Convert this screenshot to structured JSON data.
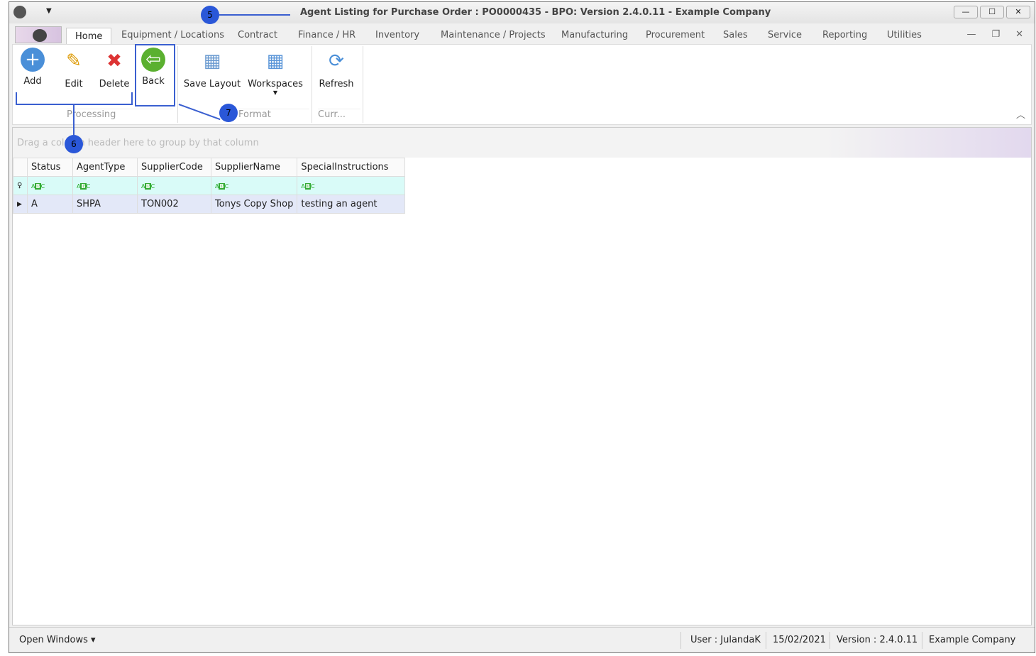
{
  "window": {
    "title": "Agent Listing for Purchase Order : PO0000435 - BPO: Version 2.4.0.11 - Example Company",
    "buttons": [
      "—",
      "☐",
      "✕"
    ]
  },
  "tabs": [
    "Home",
    "Equipment / Locations",
    "Contract",
    "Finance / HR",
    "Inventory",
    "Maintenance / Projects",
    "Manufacturing",
    "Procurement",
    "Sales",
    "Service",
    "Reporting",
    "Utilities"
  ],
  "ribbon": {
    "add": "Add",
    "edit": "Edit",
    "delete": "Delete",
    "back": "Back",
    "save_layout": "Save Layout",
    "workspaces": "Workspaces",
    "refresh": "Refresh",
    "group_processing": "Processing",
    "group_format": "Format",
    "group_curr": "Curr..."
  },
  "grid": {
    "group_hint": "Drag a column header here to group by that column",
    "columns": [
      "Status",
      "AgentType",
      "SupplierCode",
      "SupplierName",
      "SpecialInstructions"
    ],
    "rows": [
      [
        "A",
        "SHPA",
        "TON002",
        "Tonys Copy Shop",
        "testing an agent"
      ]
    ]
  },
  "statusbar": {
    "open_windows": "Open Windows ▾",
    "user": "User : JulandaK",
    "date": "15/02/2021",
    "version": "Version : 2.4.0.11",
    "company": "Example Company"
  },
  "annotations": [
    "5",
    "6",
    "7"
  ]
}
